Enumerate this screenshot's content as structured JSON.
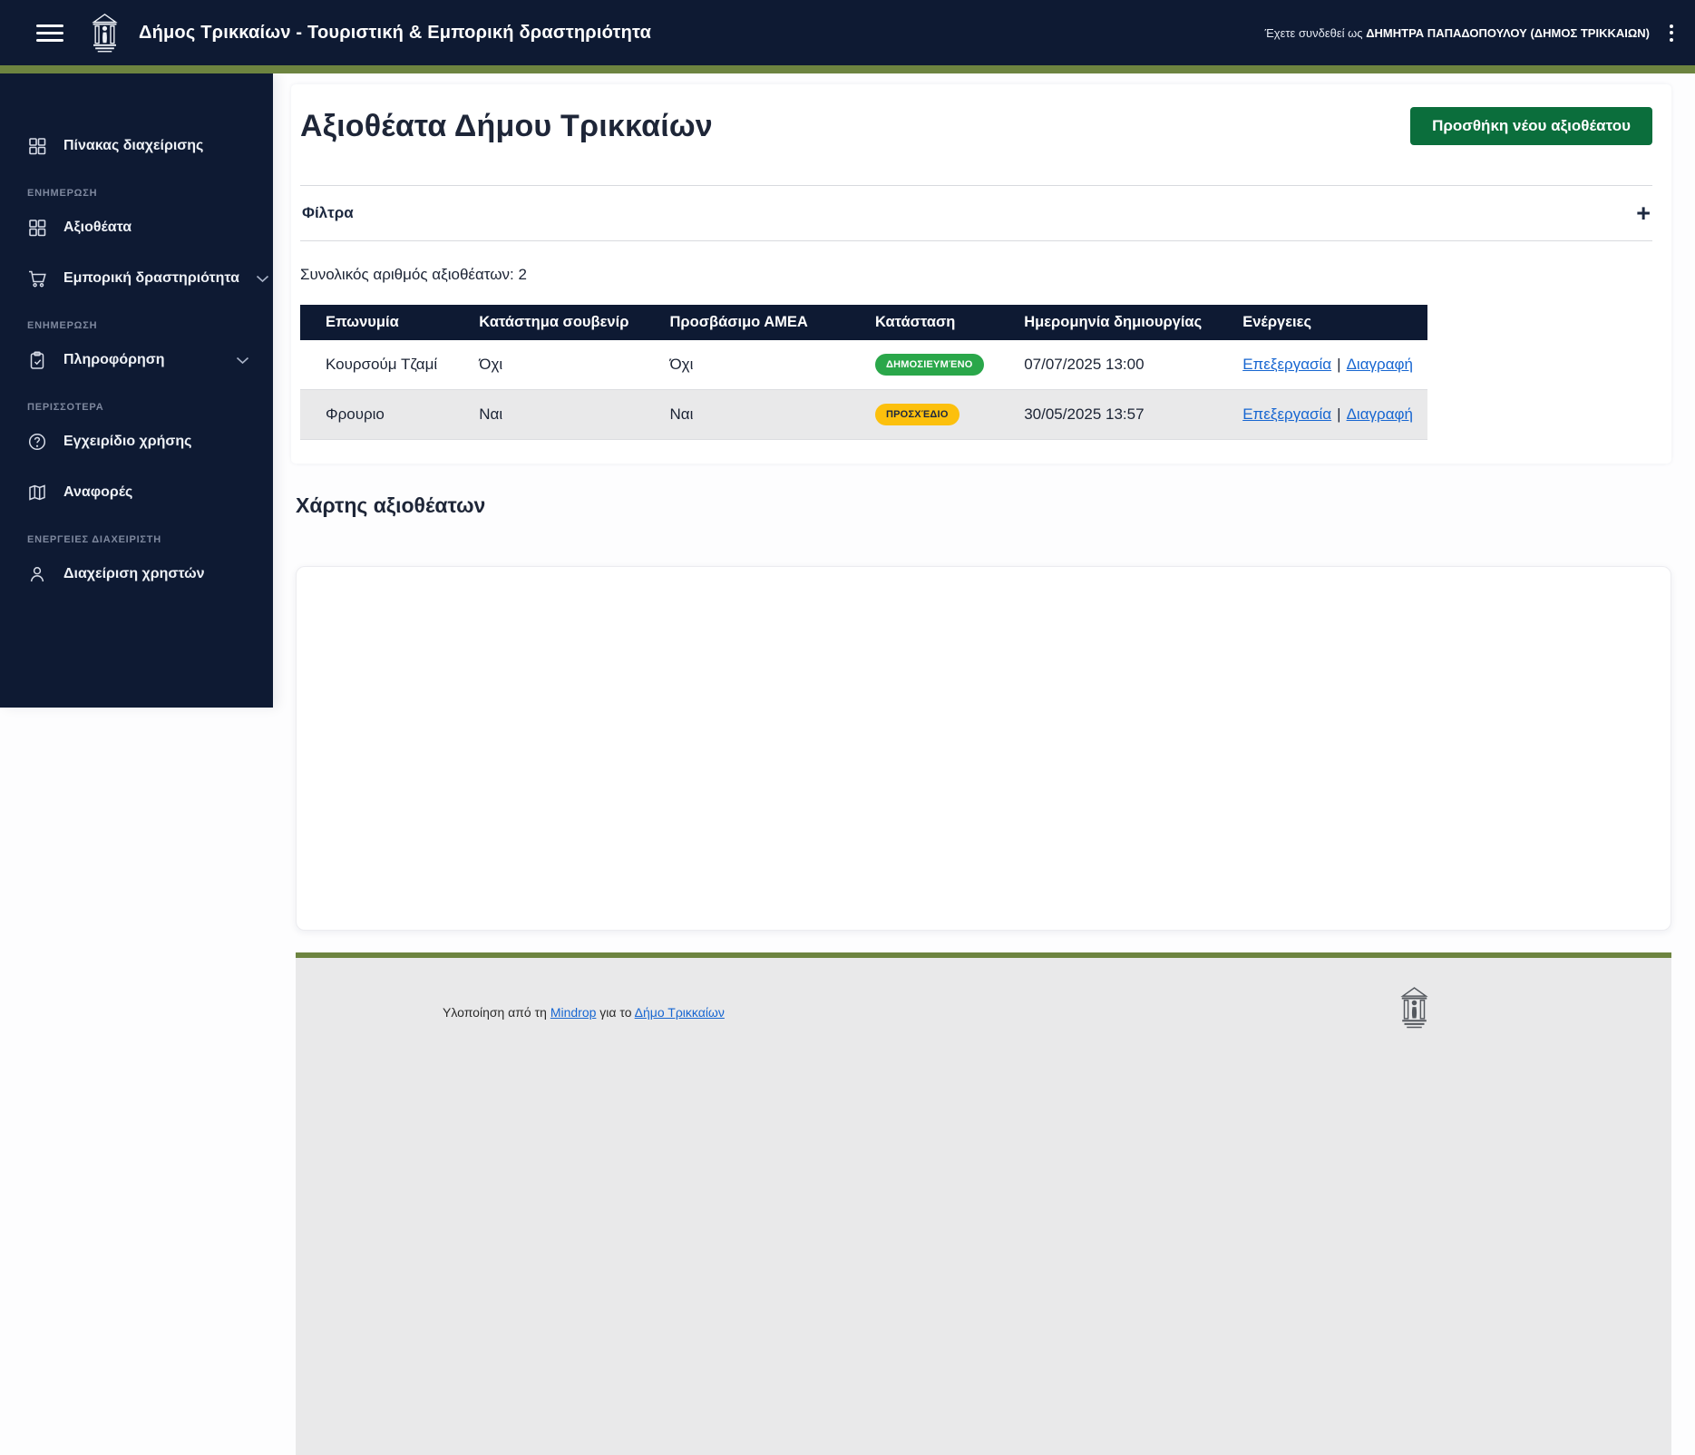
{
  "header": {
    "title": "Δήμος Τρικκαίων - Τουριστική & Εμπορική δραστηριότητα",
    "signed_in_prefix": "Έχετε συνδεθεί ως",
    "signed_in_user": "ΔΗΜΗΤΡΑ ΠΑΠΑΔΟΠΟΥΛΟΥ (ΔΗΜΟΣ ΤΡΙΚΚΑΙΩΝ)"
  },
  "sidebar": {
    "items": [
      {
        "type": "item",
        "label": "Πίνακας διαχείρισης",
        "icon": "dashboard-grid-icon"
      },
      {
        "type": "section",
        "label": "ΕΝΗΜΕΡΩΣΗ"
      },
      {
        "type": "item",
        "label": "Αξιοθέατα",
        "icon": "grid-icon"
      },
      {
        "type": "item",
        "label": "Εμπορική δραστηριότητα",
        "icon": "cart-icon",
        "chevron": true
      },
      {
        "type": "section",
        "label": "ΕΝΗΜΕΡΩΣΗ"
      },
      {
        "type": "item",
        "label": "Πληροφόρηση",
        "icon": "clipboard-icon",
        "chevron": true
      },
      {
        "type": "section",
        "label": "ΠΕΡΙΣΣΟΤΕΡΑ"
      },
      {
        "type": "item",
        "label": "Εγχειρίδιο χρήσης",
        "icon": "help-icon"
      },
      {
        "type": "item",
        "label": "Αναφορές",
        "icon": "map-icon"
      },
      {
        "type": "section",
        "label": "ΕΝΕΡΓΕΙΕΣ ΔΙΑΧΕΙΡΙΣΤΗ"
      },
      {
        "type": "item",
        "label": "Διαχείριση χρηστών",
        "icon": "user-icon"
      }
    ]
  },
  "main": {
    "page_title": "Αξιοθέατα Δήμου Τρικκαίων",
    "add_button": "Προσθήκη νέου αξιοθέατου",
    "filters_label": "Φίλτρα",
    "filters_toggle": "+",
    "total_count": "Συνολικός αριθμός αξιοθέατων: 2",
    "table": {
      "columns": [
        "Επωνυμία",
        "Κατάστημα σουβενίρ",
        "Προσβάσιμο ΑΜΕΑ",
        "Κατάσταση",
        "Ημερομηνία δημιουργίας",
        "Ενέργειες"
      ],
      "rows": [
        {
          "name": "Κουρσούμ Τζαμί",
          "souvenir_shop": "Όχι",
          "accessible_amea": "Όχι",
          "status": "ΔΗΜΟΣΙΕΥΜΈΝΟ",
          "created_at": "07/07/2025 13:00",
          "action_edit": "Επεξεργασία",
          "action_separator": "|",
          "action_delete": "Διαγραφή"
        },
        {
          "name": "Φρουριο",
          "souvenir_shop": "Ναι",
          "accessible_amea": "Ναι",
          "status": "ΠΡΟΣΧΈΔΙΟ",
          "created_at": "30/05/2025 13:57",
          "action_edit": "Επεξεργασία",
          "action_separator": "|",
          "action_delete": "Διαγραφή"
        }
      ]
    },
    "map_title": "Χάρτης αξιοθέατων"
  },
  "footer": {
    "prefix": "Υλοποίηση από τη",
    "link_mindrop": "Mindrop",
    "middle": "για το",
    "link_municipality": "Δήμο Τρικκαίων"
  },
  "colors": {
    "header_bg": "#0e1a33",
    "accent_olive": "#6d8440",
    "button_green": "#0b6e3c",
    "status_published_bg": "#2aa74a",
    "status_draft_bg": "#fcc00d",
    "link_blue": "#1766d1",
    "table_header_bg": "#0e1a33",
    "row_alt_bg": "#e9e9ea",
    "footer_bg": "#e9e9ea"
  }
}
